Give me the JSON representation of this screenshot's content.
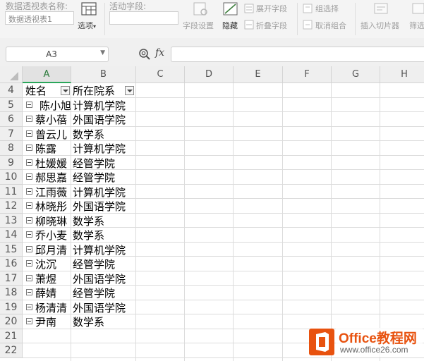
{
  "ribbon": {
    "pivot_name_label": "数据透视表名称:",
    "pivot_name_value": "数据透视表1",
    "options_label": "选项",
    "active_field_label": "活动字段:",
    "active_field_value": "",
    "field_settings_label": "字段设置",
    "hide_label": "隐藏",
    "expand_field_label": "展开字段",
    "collapse_field_label": "折叠字段",
    "group_selection_label": "组选择",
    "ungroup_label": "取消组合",
    "insert_slicer_label": "插入切片器",
    "filter_label": "筛选"
  },
  "formula_bar": {
    "name_box": "A3",
    "fx_symbol": "fx",
    "formula_value": ""
  },
  "grid": {
    "columns": [
      "A",
      "B",
      "C",
      "D",
      "E",
      "F",
      "G",
      "H"
    ],
    "rows": [
      "4",
      "5",
      "6",
      "7",
      "8",
      "9",
      "10",
      "11",
      "12",
      "13",
      "14",
      "15",
      "16",
      "17",
      "18",
      "19",
      "20",
      "21",
      "22"
    ],
    "header": {
      "name": "姓名",
      "dept": "所在院系"
    },
    "records": [
      {
        "name": "陈小旭",
        "dept": "计算机学院"
      },
      {
        "name": "蔡小蓓",
        "dept": "外国语学院"
      },
      {
        "name": "曾云儿",
        "dept": "数学系"
      },
      {
        "name": "陈露",
        "dept": "计算机学院"
      },
      {
        "name": "杜媛媛",
        "dept": "经管学院"
      },
      {
        "name": "郝思嘉",
        "dept": "经管学院"
      },
      {
        "name": "江雨薇",
        "dept": "计算机学院"
      },
      {
        "name": "林晓彤",
        "dept": "外国语学院"
      },
      {
        "name": "柳晓琳",
        "dept": "数学系"
      },
      {
        "name": "乔小麦",
        "dept": "数学系"
      },
      {
        "name": "邱月清",
        "dept": "计算机学院"
      },
      {
        "name": "沈沉",
        "dept": "经管学院"
      },
      {
        "name": "萧煜",
        "dept": "外国语学院"
      },
      {
        "name": "薛婧",
        "dept": "经管学院"
      },
      {
        "name": "杨清清",
        "dept": "外国语学院"
      },
      {
        "name": "尹南",
        "dept": "数学系"
      }
    ]
  },
  "watermark": {
    "brand": "Office教程网",
    "url": "www.office26.com",
    "accent": "#e8520f"
  }
}
